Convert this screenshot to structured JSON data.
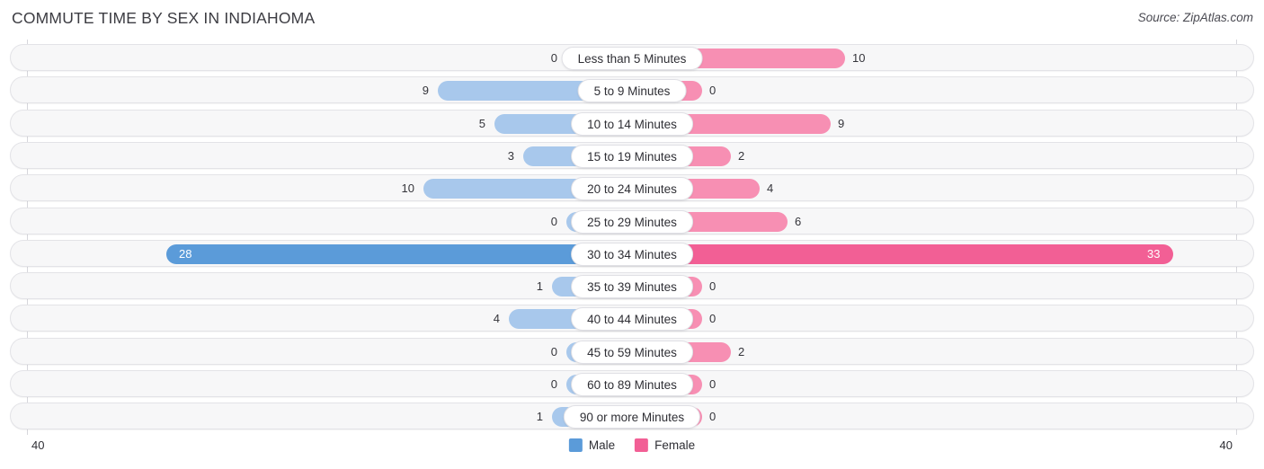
{
  "header": {
    "title": "COMMUTE TIME BY SEX IN INDIAHOMA",
    "source": "Source: ZipAtlas.com"
  },
  "legend": {
    "male_label": "Male",
    "female_label": "Female",
    "male_color": "#5b9bd9",
    "female_color": "#f25f95"
  },
  "axis": {
    "left_tick": "40",
    "right_tick": "40"
  },
  "colors": {
    "male_bar": "#a8c8ec",
    "female_bar": "#f78fb3",
    "male_bar_peak": "#5b9bd9",
    "female_bar_peak": "#f25f95",
    "row_background": "#f7f7f8"
  },
  "chart_data": {
    "type": "bar",
    "title": "COMMUTE TIME BY SEX IN INDIAHOMA",
    "subtitle": "Source: ZipAtlas.com",
    "orientation": "horizontal-diverging",
    "xlabel": "",
    "ylabel": "",
    "xlim": [
      40,
      40
    ],
    "grid": false,
    "legend_position": "bottom-center",
    "categories": [
      "Less than 5 Minutes",
      "5 to 9 Minutes",
      "10 to 14 Minutes",
      "15 to 19 Minutes",
      "20 to 24 Minutes",
      "25 to 29 Minutes",
      "30 to 34 Minutes",
      "35 to 39 Minutes",
      "40 to 44 Minutes",
      "45 to 59 Minutes",
      "60 to 89 Minutes",
      "90 or more Minutes"
    ],
    "series": [
      {
        "name": "Male",
        "color": "#5b9bd9",
        "direction": "left",
        "values": [
          0,
          9,
          5,
          3,
          10,
          0,
          28,
          1,
          4,
          0,
          0,
          1
        ]
      },
      {
        "name": "Female",
        "color": "#f25f95",
        "direction": "right",
        "values": [
          10,
          0,
          9,
          2,
          4,
          6,
          33,
          0,
          0,
          2,
          0,
          0
        ]
      }
    ]
  },
  "rows": [
    {
      "label": "Less than 5 Minutes",
      "male": "0",
      "female": "10",
      "male_w": 75,
      "female_w": 234,
      "peak": false
    },
    {
      "label": "5 to 9 Minutes",
      "male": "9",
      "female": "0",
      "male_w": 218,
      "female_w": 75,
      "peak": false
    },
    {
      "label": "10 to 14 Minutes",
      "male": "5",
      "female": "9",
      "male_w": 155,
      "female_w": 218,
      "peak": false
    },
    {
      "label": "15 to 19 Minutes",
      "male": "3",
      "female": "2",
      "male_w": 123,
      "female_w": 107,
      "peak": false
    },
    {
      "label": "20 to 24 Minutes",
      "male": "10",
      "female": "4",
      "male_w": 234,
      "female_w": 139,
      "peak": false
    },
    {
      "label": "25 to 29 Minutes",
      "male": "0",
      "female": "6",
      "male_w": 75,
      "female_w": 170,
      "peak": false
    },
    {
      "label": "30 to 34 Minutes",
      "male": "28",
      "female": "33",
      "male_w": 520,
      "female_w": 599,
      "peak": true
    },
    {
      "label": "35 to 39 Minutes",
      "male": "1",
      "female": "0",
      "male_w": 91,
      "female_w": 75,
      "peak": false
    },
    {
      "label": "40 to 44 Minutes",
      "male": "4",
      "female": "0",
      "male_w": 139,
      "female_w": 75,
      "peak": false
    },
    {
      "label": "45 to 59 Minutes",
      "male": "0",
      "female": "2",
      "male_w": 75,
      "female_w": 107,
      "peak": false
    },
    {
      "label": "60 to 89 Minutes",
      "male": "0",
      "female": "0",
      "male_w": 75,
      "female_w": 75,
      "peak": false
    },
    {
      "label": "90 or more Minutes",
      "male": "1",
      "female": "0",
      "male_w": 91,
      "female_w": 75,
      "peak": false
    }
  ]
}
